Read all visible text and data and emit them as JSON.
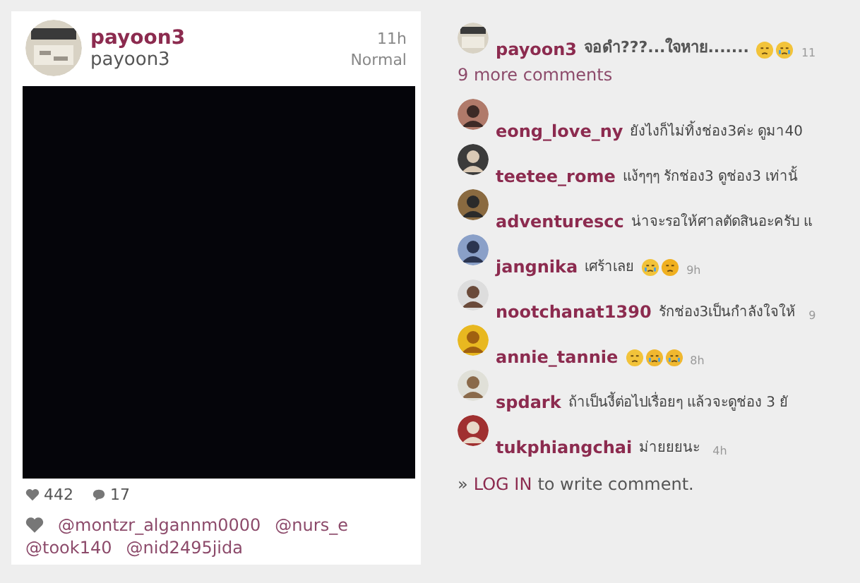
{
  "post": {
    "username": "payoon3",
    "time": "11h",
    "subtitle": "payoon3",
    "filter": "Normal",
    "likes": "442",
    "comments": "17",
    "liked_by": [
      "@montzr_algannm0000",
      "@nurs_e",
      "@took140",
      "@nid2495jida"
    ]
  },
  "caption": {
    "username": "payoon3",
    "text": "จอดำ???...ใจหาย.......",
    "emojis": [
      {
        "kind": "sad"
      },
      {
        "kind": "cry"
      }
    ],
    "time": "11"
  },
  "more_comments": "9 more comments",
  "comments": [
    {
      "username": "eong_love_ny",
      "text": "ยังไงก็ไม่ทิ้งช่อง3ค่ะ ดูมา40"
    },
    {
      "username": "teetee_rome",
      "text": "แง้ๆๆๆ รักช่อง3 ดูช่อง3 เท่านั้"
    },
    {
      "username": "adventurescc",
      "text": "น่าจะรอให้ศาลตัดสินอะครับ แ"
    },
    {
      "username": "jangnika",
      "text": "เศร้าเลย",
      "emojis": [
        {
          "kind": "cry"
        },
        {
          "kind": "tired"
        }
      ],
      "time": "9h"
    },
    {
      "username": "nootchanat1390",
      "text": "รักช่อง3เป็นกำลังใจให้",
      "time": "9"
    },
    {
      "username": "annie_tannie",
      "emojis": [
        {
          "kind": "sad"
        },
        {
          "kind": "tears"
        },
        {
          "kind": "tears"
        }
      ],
      "time": "8h"
    },
    {
      "username": "spdark",
      "text": "ถ้าเป็นงี้ต่อไปเรื่อยๆ แล้วจะดูช่อง 3 ยั"
    },
    {
      "username": "tukphiangchai",
      "text": "ม่ายยยนะ",
      "time": "4h"
    }
  ],
  "login": {
    "prefix": "»",
    "link": "LOG IN",
    "text": "to write comment."
  }
}
